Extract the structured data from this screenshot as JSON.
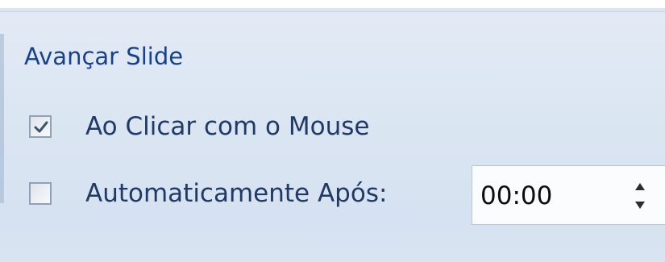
{
  "panel": {
    "title": "Avançar Slide"
  },
  "options": {
    "on_mouse_click": {
      "label": "Ao Clicar com o Mouse",
      "checked": true
    },
    "automatically_after": {
      "label": "Automaticamente Após:",
      "checked": false,
      "time_value": "00:00"
    }
  },
  "icons": {
    "checkmark": "check-icon",
    "spin_up": "spinner-up-icon",
    "spin_down": "spinner-down-icon"
  },
  "colors": {
    "title": "#15428b",
    "label": "#1f3a66",
    "panel_background": "#dce6f3"
  }
}
